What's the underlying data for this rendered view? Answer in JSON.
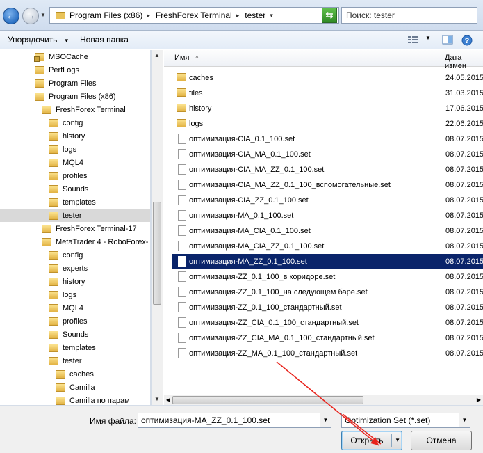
{
  "address": {
    "crumbs": [
      "Program Files (x86)",
      "FreshForex Terminal",
      "tester"
    ]
  },
  "search": {
    "placeholder": "Поиск: tester"
  },
  "toolbar": {
    "organize_label": "Упорядочить",
    "new_folder_label": "Новая папка"
  },
  "nav": {
    "items": [
      {
        "label": "MSOCache",
        "indent": 0,
        "lock": true
      },
      {
        "label": "PerfLogs",
        "indent": 0,
        "lock": false
      },
      {
        "label": "Program Files",
        "indent": 0,
        "lock": false
      },
      {
        "label": "Program Files (x86)",
        "indent": 0,
        "lock": false
      },
      {
        "label": "FreshForex Terminal",
        "indent": 1,
        "lock": false
      },
      {
        "label": "config",
        "indent": 2,
        "lock": false
      },
      {
        "label": "history",
        "indent": 2,
        "lock": false
      },
      {
        "label": "logs",
        "indent": 2,
        "lock": false
      },
      {
        "label": "MQL4",
        "indent": 2,
        "lock": false
      },
      {
        "label": "profiles",
        "indent": 2,
        "lock": false
      },
      {
        "label": "Sounds",
        "indent": 2,
        "lock": false
      },
      {
        "label": "templates",
        "indent": 2,
        "lock": false
      },
      {
        "label": "tester",
        "indent": 2,
        "lock": false,
        "selected": true
      },
      {
        "label": "FreshForex Terminal-17",
        "indent": 1,
        "lock": false
      },
      {
        "label": "MetaTrader 4 - RoboForex-",
        "indent": 1,
        "lock": false
      },
      {
        "label": "config",
        "indent": 2,
        "lock": false
      },
      {
        "label": "experts",
        "indent": 2,
        "lock": false
      },
      {
        "label": "history",
        "indent": 2,
        "lock": false
      },
      {
        "label": "logs",
        "indent": 2,
        "lock": false
      },
      {
        "label": "MQL4",
        "indent": 2,
        "lock": false
      },
      {
        "label": "profiles",
        "indent": 2,
        "lock": false
      },
      {
        "label": "Sounds",
        "indent": 2,
        "lock": false
      },
      {
        "label": "templates",
        "indent": 2,
        "lock": false
      },
      {
        "label": "tester",
        "indent": 2,
        "lock": false
      },
      {
        "label": "caches",
        "indent": 3,
        "lock": false
      },
      {
        "label": "Camilla",
        "indent": 3,
        "lock": false
      },
      {
        "label": "Camilla по парам",
        "indent": 3,
        "lock": false
      }
    ]
  },
  "list": {
    "col_name": "Имя",
    "col_date": "Дата измен",
    "files": [
      {
        "name": "caches",
        "date": "24.05.2015",
        "type": "folder"
      },
      {
        "name": "files",
        "date": "31.03.2015",
        "type": "folder"
      },
      {
        "name": "history",
        "date": "17.06.2015",
        "type": "folder"
      },
      {
        "name": "logs",
        "date": "22.06.2015",
        "type": "folder"
      },
      {
        "name": "оптимизация-CIA_0.1_100.set",
        "date": "08.07.2015",
        "type": "file"
      },
      {
        "name": "оптимизация-CIA_MA_0.1_100.set",
        "date": "08.07.2015",
        "type": "file"
      },
      {
        "name": "оптимизация-CIA_MA_ZZ_0.1_100.set",
        "date": "08.07.2015",
        "type": "file"
      },
      {
        "name": "оптимизация-CIA_MA_ZZ_0.1_100_вспомогательные.set",
        "date": "08.07.2015",
        "type": "file"
      },
      {
        "name": "оптимизация-CIA_ZZ_0.1_100.set",
        "date": "08.07.2015",
        "type": "file"
      },
      {
        "name": "оптимизация-MA_0.1_100.set",
        "date": "08.07.2015",
        "type": "file"
      },
      {
        "name": "оптимизация-MA_CIA_0.1_100.set",
        "date": "08.07.2015",
        "type": "file"
      },
      {
        "name": "оптимизация-MA_CIA_ZZ_0.1_100.set",
        "date": "08.07.2015",
        "type": "file"
      },
      {
        "name": "оптимизация-MA_ZZ_0.1_100.set",
        "date": "08.07.2015",
        "type": "file",
        "selected": true
      },
      {
        "name": "оптимизация-ZZ_0.1_100_в коридоре.set",
        "date": "08.07.2015",
        "type": "file"
      },
      {
        "name": "оптимизация-ZZ_0.1_100_на следующем баре.set",
        "date": "08.07.2015",
        "type": "file"
      },
      {
        "name": "оптимизация-ZZ_0.1_100_стандартный.set",
        "date": "08.07.2015",
        "type": "file"
      },
      {
        "name": "оптимизация-ZZ_CIA_0.1_100_стандартный.set",
        "date": "08.07.2015",
        "type": "file"
      },
      {
        "name": "оптимизация-ZZ_CIA_MA_0.1_100_стандартный.set",
        "date": "08.07.2015",
        "type": "file"
      },
      {
        "name": "оптимизация-ZZ_MA_0.1_100_стандартный.set",
        "date": "08.07.2015",
        "type": "file"
      }
    ]
  },
  "bottom": {
    "filename_label": "Имя файла:",
    "filename_value": "оптимизация-MA_ZZ_0.1_100.set",
    "filetype_value": "Optimization Set (*.set)",
    "open_label": "Открыть",
    "cancel_label": "Отмена"
  },
  "colors": {
    "selection": "#0a246a",
    "annotation_arrow": "#e8231c"
  }
}
